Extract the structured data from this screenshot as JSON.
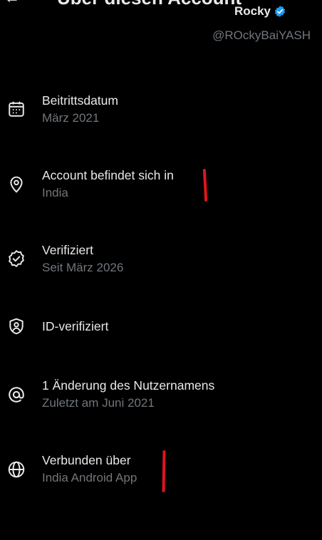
{
  "header": {
    "title": "Über diesen Account",
    "display_name": "Rocky",
    "handle": "@ROckyBaiYASH",
    "back_icon": "back-arrow-icon",
    "badge_color": "#1d9bf0"
  },
  "items": [
    {
      "icon": "calendar-icon",
      "title": "Beitrittsdatum",
      "subtitle": "März 2021"
    },
    {
      "icon": "location-pin-icon",
      "title": "Account befindet sich in",
      "subtitle": "India"
    },
    {
      "icon": "verified-check-icon",
      "title": "Verifiziert",
      "subtitle": "Seit März 2026"
    },
    {
      "icon": "id-shield-icon",
      "title": "ID-verifiziert"
    },
    {
      "icon": "at-sign-icon",
      "title": "1 Änderung des Nutzernamens",
      "subtitle": "Zuletzt am Juni 2021"
    },
    {
      "icon": "globe-icon",
      "title": "Verbunden über",
      "subtitle": "India Android App"
    }
  ],
  "colors": {
    "background": "#000000",
    "primary_text": "#e7e9ea",
    "secondary_text": "#71767b",
    "annotation_mark": "#e0141e"
  }
}
